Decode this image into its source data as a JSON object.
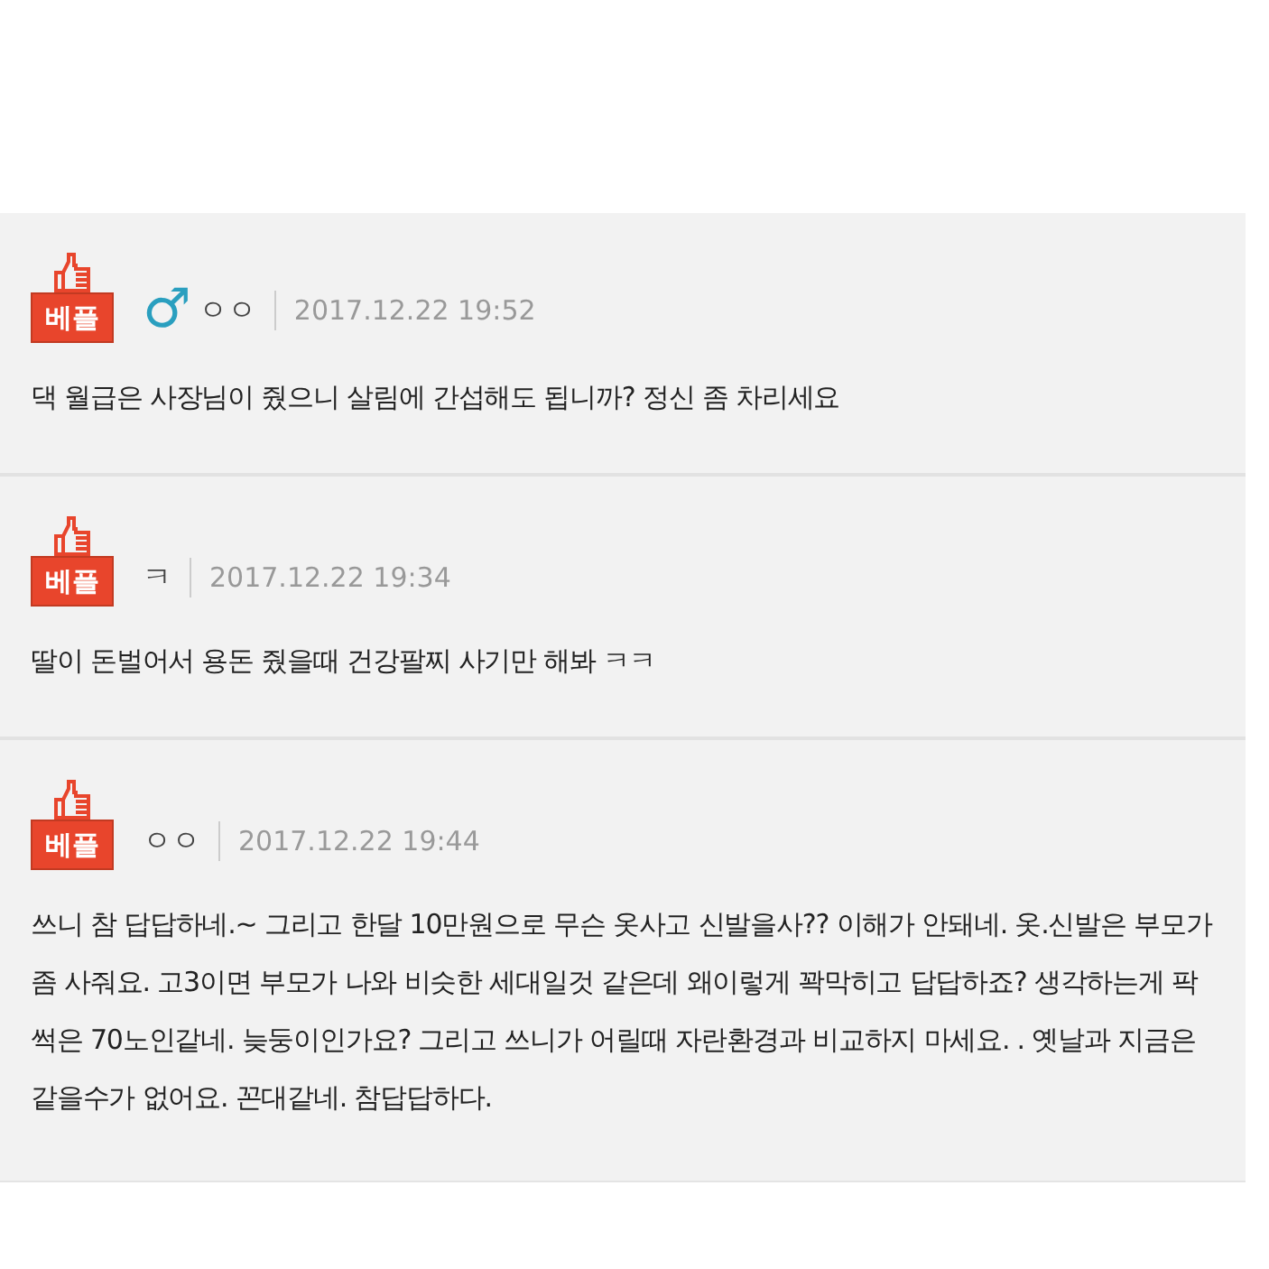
{
  "comments": [
    {
      "badge": "베플",
      "gender_symbol": "♂",
      "author": "ㅇㅇ",
      "date": "2017.12.22 19:52",
      "text": "댁 월급은 사장님이 줬으니 살림에 간섭해도 됩니까? 정신 좀 차리세요"
    },
    {
      "badge": "베플",
      "author": "ㅋ",
      "date": "2017.12.22 19:34",
      "text": "딸이 돈벌어서 용돈 줬을때 건강팔찌 사기만 해봐 ㅋㅋ"
    },
    {
      "badge": "베플",
      "author": "ㅇㅇ",
      "date": "2017.12.22 19:44",
      "text": "쓰니 참 답답하네.~ 그리고 한달 10만원으로 무슨 옷사고 신발을사?? 이해가 안돼네. 옷.신발은 부모가 좀 사줘요. 고3이면 부모가 나와 비슷한 세대일것 같은데 왜이렇게 꽉막히고 답답하죠? 생각하는게 팍썩은 70노인같네. 늦둥이인가요? 그리고 쓰니가 어릴때 자란환경과 비교하지 마세요. . 옛날과 지금은 같을수가 없어요. 꼰대같네. 참답답하다."
    }
  ]
}
